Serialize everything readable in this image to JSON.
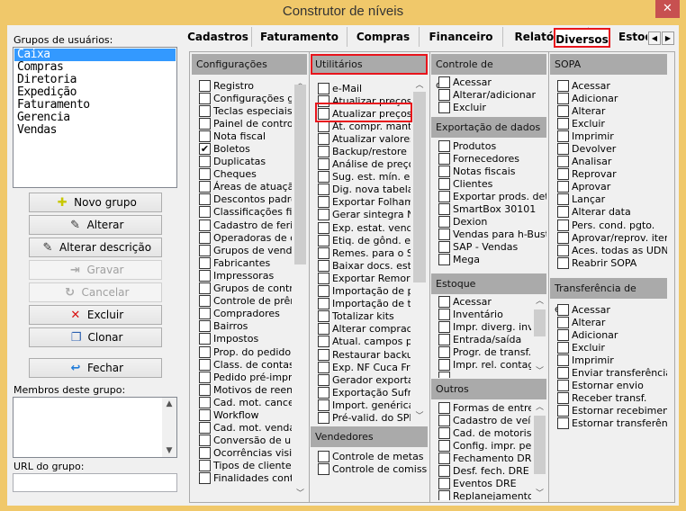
{
  "window": {
    "title": "Construtor de níveis",
    "close": "✕"
  },
  "groups": {
    "label": "Grupos de usuários:",
    "items": [
      "Caixa",
      "Compras",
      "Diretoria",
      "Expedição",
      "Faturamento",
      "Gerencia",
      "Vendas"
    ],
    "selected": "Caixa"
  },
  "buttons": [
    {
      "key": "novo-grupo",
      "label": "Novo grupo",
      "icon": "new-group-icon",
      "glyph": "✚",
      "color": "#c8c800",
      "enabled": true
    },
    {
      "key": "alterar",
      "label": "Alterar",
      "icon": "edit-icon",
      "glyph": "✎",
      "color": "#333",
      "enabled": true
    },
    {
      "key": "alterar-descricao",
      "label": "Alterar descrição",
      "icon": "edit-description-icon",
      "glyph": "✎",
      "color": "#333",
      "enabled": true
    },
    {
      "key": "gravar",
      "label": "Gravar",
      "icon": "save-icon",
      "glyph": "⇥",
      "color": "#aaa",
      "enabled": false
    },
    {
      "key": "cancelar",
      "label": "Cancelar",
      "icon": "cancel-icon",
      "glyph": "↻",
      "color": "#aaa",
      "enabled": false
    },
    {
      "key": "excluir",
      "label": "Excluir",
      "icon": "delete-x-icon",
      "glyph": "✕",
      "color": "#d81010",
      "enabled": true
    },
    {
      "key": "clonar",
      "label": "Clonar",
      "icon": "clone-icon",
      "glyph": "❐",
      "color": "#2a5fb0",
      "enabled": true
    },
    {
      "key": "fechar",
      "label": "Fechar",
      "icon": "close-door-icon",
      "glyph": "↩",
      "color": "#1e7ad8",
      "enabled": true
    }
  ],
  "members": {
    "label": "Membros deste grupo:"
  },
  "url": {
    "label": "URL do grupo:",
    "value": ""
  },
  "tabs": [
    "Cadastros",
    "Faturamento",
    "Compras",
    "Financeiro",
    "Relatórios",
    "Diversos",
    "Estoque"
  ],
  "active_tab": "Diversos",
  "sections": {
    "configuracoes": {
      "title": "Configurações",
      "items": [
        [
          "Registro",
          false
        ],
        [
          "Configurações gerais",
          false
        ],
        [
          "Teclas especiais",
          false
        ],
        [
          "Painel de controle",
          false
        ],
        [
          "Nota fiscal",
          false
        ],
        [
          "Boletos",
          true
        ],
        [
          "Duplicatas",
          false
        ],
        [
          "Cheques",
          false
        ],
        [
          "Áreas de atuação",
          false
        ],
        [
          "Descontos padrões",
          false
        ],
        [
          "Classificações fiscais",
          false
        ],
        [
          "Cadastro de feriados",
          false
        ],
        [
          "Operadoras de cartão",
          false
        ],
        [
          "Grupos de vendedores",
          false
        ],
        [
          "Fabricantes",
          false
        ],
        [
          "Impressoras",
          false
        ],
        [
          "Grupos de controle",
          false
        ],
        [
          "Controle de prêmios",
          false
        ],
        [
          "Compradores",
          false
        ],
        [
          "Bairros",
          false
        ],
        [
          "Impostos",
          false
        ],
        [
          "Prop. do pedido",
          false
        ],
        [
          "Class. de contas",
          false
        ],
        [
          "Pedido pré-impresso",
          false
        ],
        [
          "Motivos de reentrega",
          false
        ],
        [
          "Cad. mot. cancel.",
          false
        ],
        [
          "Workflow",
          false
        ],
        [
          "Cad. mot. vendas",
          false
        ],
        [
          "Conversão de unidades",
          false
        ],
        [
          "Ocorrências visitas",
          false
        ],
        [
          "Tipos de cliente",
          false
        ],
        [
          "Finalidades contrato",
          false
        ]
      ]
    },
    "utilitarios": {
      "title": "Utilitários",
      "items": [
        [
          "e-Mail",
          false
        ],
        [
          "Atualizar preços",
          false
        ],
        [
          "Atualizar preços p",
          false
        ],
        [
          "At. compr. mant.",
          false
        ],
        [
          "Atualizar valores l",
          false
        ],
        [
          "Backup/restore",
          false
        ],
        [
          "Análise de preços",
          false
        ],
        [
          "Sug. est. mín. e m",
          false
        ],
        [
          "Dig. nova tabela",
          false
        ],
        [
          "Exportar Folhamatic",
          false
        ],
        [
          "Gerar sintegra NF",
          false
        ],
        [
          "Exp. estat. vend.",
          false
        ],
        [
          "Etiq. de gônd. em",
          false
        ],
        [
          "Remes. para o Se",
          false
        ],
        [
          "Baixar docs. est.",
          false
        ],
        [
          "Exportar Remora",
          false
        ],
        [
          "Importação de pr",
          false
        ],
        [
          "Importação de tin",
          false
        ],
        [
          "Totalizar kits",
          false
        ],
        [
          "Alterar comprador",
          false
        ],
        [
          "Atual. campos pro",
          false
        ],
        [
          "Restaurar backup",
          false
        ],
        [
          "Exp. NF Cuca Fresca",
          false
        ],
        [
          "Gerador exportação",
          false
        ],
        [
          "Exportação Sufra",
          false
        ],
        [
          "Import. genérica",
          false
        ],
        [
          "Pré-valid. do SPED",
          false
        ]
      ]
    },
    "vendedores": {
      "title": "Vendedores",
      "items": [
        [
          "Controle de metas",
          false
        ],
        [
          "Controle de comissões",
          false
        ]
      ]
    },
    "chamadas": {
      "title": "Controle de chamadas",
      "items": [
        [
          "Acessar",
          false
        ],
        [
          "Alterar/adicionar",
          false
        ],
        [
          "Excluir",
          false
        ]
      ]
    },
    "exportacao": {
      "title": "Exportação de dados",
      "items": [
        [
          "Produtos",
          false
        ],
        [
          "Fornecedores",
          false
        ],
        [
          "Notas fiscais",
          false
        ],
        [
          "Clientes",
          false
        ],
        [
          "Exportar prods. detalh",
          false
        ],
        [
          "SmartBox 30101",
          false
        ],
        [
          "Dexion",
          false
        ],
        [
          "Vendas para h-Buster",
          false
        ],
        [
          "SAP - Vendas",
          false
        ],
        [
          "Mega",
          false
        ]
      ]
    },
    "estoque": {
      "title": "Estoque",
      "items": [
        [
          "Acessar",
          false
        ],
        [
          "Inventário",
          false
        ],
        [
          "Impr. diverg. inven",
          false
        ],
        [
          "Entrada/saída",
          false
        ],
        [
          "Progr. de transf.",
          false
        ],
        [
          "Impr. rel. contagem",
          false
        ],
        [
          "...",
          false
        ]
      ]
    },
    "outros": {
      "title": "Outros",
      "items": [
        [
          "Formas de entrega",
          false
        ],
        [
          "Cadastro de veículos",
          false
        ],
        [
          "Cad. de motoristas",
          false
        ],
        [
          "Config. impr. ped. d",
          false
        ],
        [
          "Fechamento DRE",
          false
        ],
        [
          "Desf. fech. DRE",
          false
        ],
        [
          "Eventos DRE",
          false
        ],
        [
          "Replanejamento DRE",
          false
        ]
      ]
    },
    "sopa": {
      "title": "SOPA",
      "items": [
        [
          "Acessar",
          false
        ],
        [
          "Adicionar",
          false
        ],
        [
          "Alterar",
          false
        ],
        [
          "Excluir",
          false
        ],
        [
          "Imprimir",
          false
        ],
        [
          "Devolver",
          false
        ],
        [
          "Analisar",
          false
        ],
        [
          "Reprovar",
          false
        ],
        [
          "Aprovar",
          false
        ],
        [
          "Lançar",
          false
        ],
        [
          "Alterar data",
          false
        ],
        [
          "Pers. cond. pgto.",
          false
        ],
        [
          "Aprovar/reprov. itens",
          false
        ],
        [
          "Aces. todas as UDN's",
          false
        ],
        [
          "Reabrir SOPA",
          false
        ]
      ]
    },
    "transferencia": {
      "title": "Transferência de estoque",
      "items": [
        [
          "Acessar",
          false
        ],
        [
          "Alterar",
          false
        ],
        [
          "Adicionar",
          false
        ],
        [
          "Excluir",
          false
        ],
        [
          "Imprimir",
          false
        ],
        [
          "Enviar transferência",
          false
        ],
        [
          "Estornar envio",
          false
        ],
        [
          "Receber transf.",
          false
        ],
        [
          "Estornar recebimento",
          false
        ],
        [
          "Estornar transferência",
          false
        ]
      ]
    }
  },
  "highlight_color": "#e8141c"
}
